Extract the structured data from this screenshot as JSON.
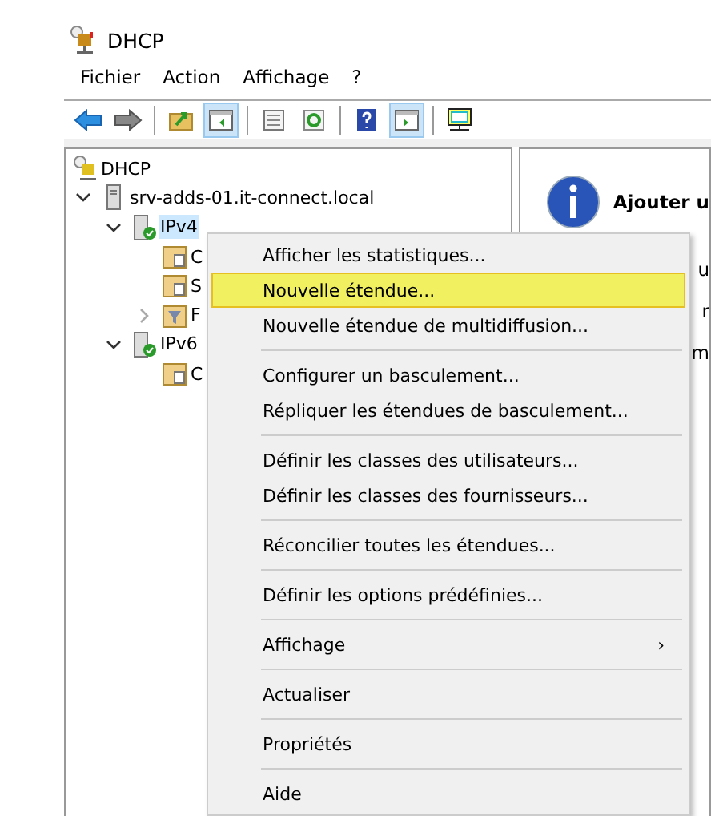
{
  "window": {
    "title": "DHCP"
  },
  "menu_bar": [
    "Fichier",
    "Action",
    "Affichage",
    "?"
  ],
  "toolbar": [
    {
      "kind": "back",
      "pressed": false
    },
    {
      "kind": "forward",
      "pressed": false
    },
    {
      "kind": "separator"
    },
    {
      "kind": "folder-up",
      "pressed": false
    },
    {
      "kind": "tree-pane",
      "pressed": true
    },
    {
      "kind": "separator"
    },
    {
      "kind": "properties",
      "pressed": false
    },
    {
      "kind": "refresh",
      "pressed": false
    },
    {
      "kind": "separator"
    },
    {
      "kind": "help",
      "pressed": false
    },
    {
      "kind": "action-pane",
      "pressed": true
    },
    {
      "kind": "separator"
    },
    {
      "kind": "monitor",
      "pressed": false
    }
  ],
  "tree": [
    {
      "label": "DHCP",
      "kind": "dhcp",
      "selected": false,
      "children": [
        {
          "label": "srv-adds-01.it-connect.local",
          "kind": "server",
          "selected": false,
          "expanded": true,
          "children": [
            {
              "label": "IPv4",
              "kind": "ip",
              "selected": true,
              "expanded": true,
              "children": [
                {
                  "label": "C",
                  "kind": "folder",
                  "selected": false
                },
                {
                  "label": "S",
                  "kind": "folder-doc",
                  "selected": false
                },
                {
                  "label": "F",
                  "kind": "filter",
                  "selected": false,
                  "expanded": false
                }
              ]
            },
            {
              "label": "IPv6",
              "kind": "ip",
              "selected": false,
              "expanded": true,
              "children": [
                {
                  "label": "C",
                  "kind": "folder",
                  "selected": false
                }
              ]
            }
          ]
        }
      ]
    }
  ],
  "right_pane": {
    "heading": "Ajouter u",
    "fragments": [
      "u",
      "r",
      "m"
    ]
  },
  "context_menu": [
    {
      "kind": "item",
      "label": "Afficher les statistiques...",
      "selected": false
    },
    {
      "kind": "item",
      "label": "Nouvelle étendue...",
      "selected": true
    },
    {
      "kind": "item",
      "label": "Nouvelle étendue de multidiffusion...",
      "selected": false
    },
    {
      "kind": "separator"
    },
    {
      "kind": "item",
      "label": "Configurer un basculement...",
      "selected": false
    },
    {
      "kind": "item",
      "label": "Répliquer les étendues de basculement...",
      "selected": false
    },
    {
      "kind": "separator"
    },
    {
      "kind": "item",
      "label": "Définir les classes des utilisateurs...",
      "selected": false
    },
    {
      "kind": "item",
      "label": "Définir les classes des fournisseurs...",
      "selected": false
    },
    {
      "kind": "separator"
    },
    {
      "kind": "item",
      "label": "Réconcilier toutes les étendues...",
      "selected": false
    },
    {
      "kind": "separator"
    },
    {
      "kind": "item",
      "label": "Définir les options prédéfinies...",
      "selected": false
    },
    {
      "kind": "separator"
    },
    {
      "kind": "submenu",
      "label": "Affichage",
      "arrow": "›",
      "selected": false
    },
    {
      "kind": "separator"
    },
    {
      "kind": "item",
      "label": "Actualiser",
      "selected": false
    },
    {
      "kind": "separator"
    },
    {
      "kind": "item",
      "label": "Propriétés",
      "selected": false
    },
    {
      "kind": "separator"
    },
    {
      "kind": "item",
      "label": "Aide",
      "selected": false
    }
  ]
}
